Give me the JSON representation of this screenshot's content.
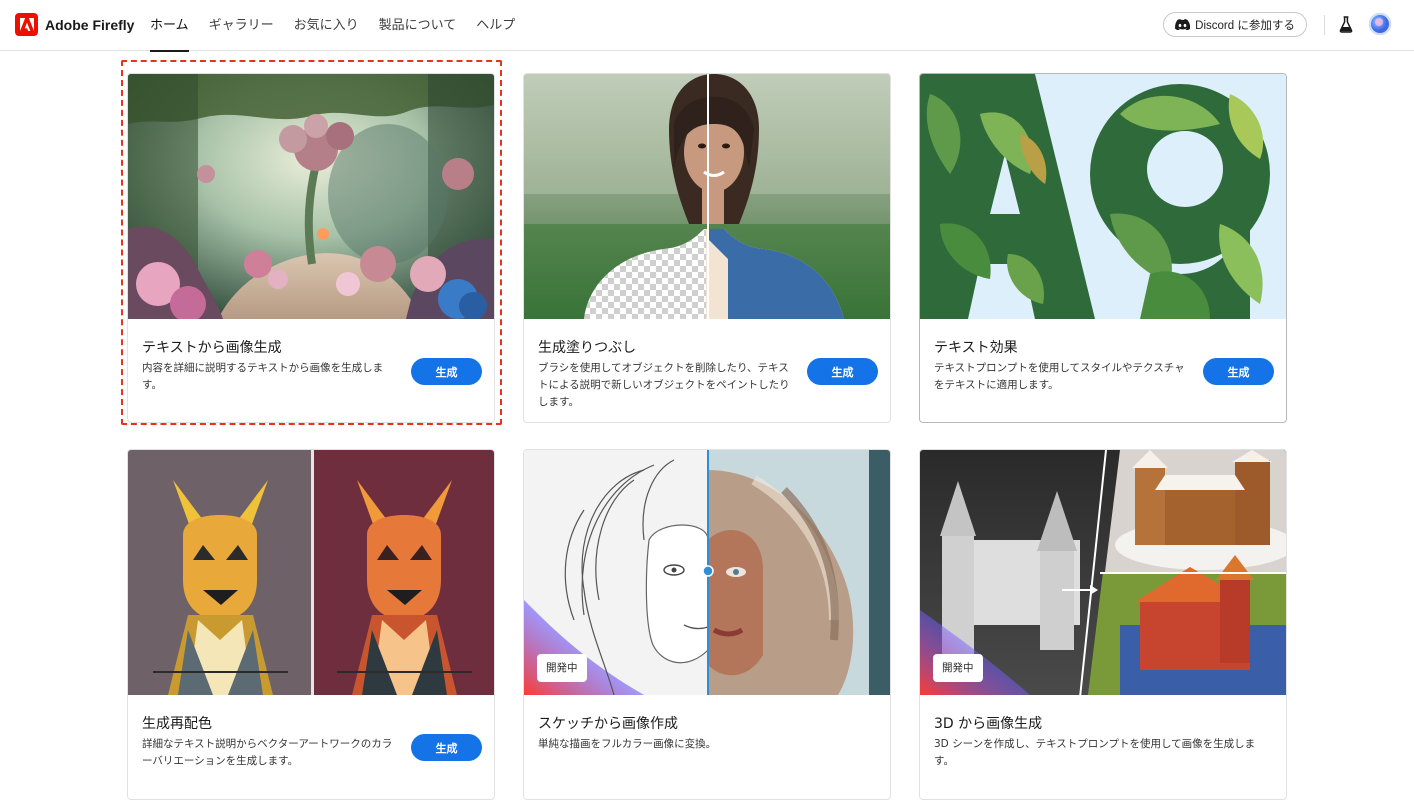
{
  "header": {
    "brand": "Adobe Firefly",
    "nav": [
      "ホーム",
      "ギャラリー",
      "お気に入り",
      "製品について",
      "ヘルプ"
    ],
    "active_nav": "ホーム",
    "discord_label": "Discord に参加する"
  },
  "cards": [
    {
      "title": "テキストから画像生成",
      "desc": "内容を詳細に説明するテキストから画像を生成します。",
      "button": "生成",
      "highlighted": true
    },
    {
      "title": "生成塗りつぶし",
      "desc": "ブラシを使用してオブジェクトを削除したり、テキストによる説明で新しいオブジェクトをペイントしたりします。",
      "button": "生成"
    },
    {
      "title": "テキスト効果",
      "desc": "テキストプロンプトを使用してスタイルやテクスチャをテキストに適用します。",
      "button": "生成"
    },
    {
      "title": "生成再配色",
      "desc": "詳細なテキスト説明からベクターアートワークのカラーバリエーションを生成します。",
      "button": "生成"
    },
    {
      "title": "スケッチから画像作成",
      "desc": "単純な描画をフルカラー画像に変換。",
      "badge": "開発中"
    },
    {
      "title": "3D から画像生成",
      "desc": "3D シーンを作成し、テキストプロンプトを使用して画像を生成します。",
      "badge": "開発中"
    }
  ],
  "colors": {
    "accent": "#1473e6",
    "brand": "#eb1000",
    "highlight": "#e8331c"
  }
}
